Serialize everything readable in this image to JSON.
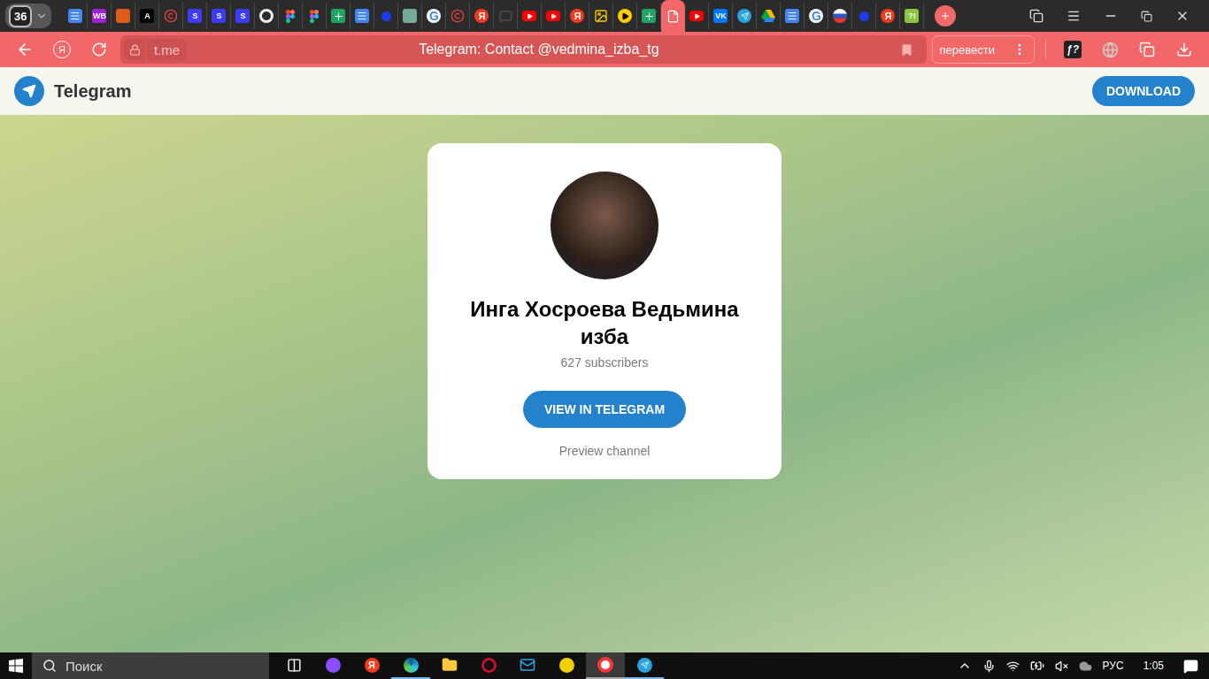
{
  "tab_counter": "36",
  "tabs": [
    {
      "kind": "docs",
      "selected": false
    },
    {
      "kind": "letter",
      "glyph": "WB",
      "color": "#a21fd6",
      "selected": false
    },
    {
      "kind": "tile",
      "color": "#e05a1a",
      "selected": false
    },
    {
      "kind": "letter",
      "glyph": "A",
      "color": "#000000",
      "selected": false
    },
    {
      "kind": "copyright",
      "selected": false
    },
    {
      "kind": "letter",
      "glyph": "S",
      "color": "#3c3cf5",
      "selected": false
    },
    {
      "kind": "letter",
      "glyph": "S",
      "color": "#3c3cf5",
      "selected": false
    },
    {
      "kind": "letter",
      "glyph": "S",
      "color": "#3c3cf5",
      "selected": false
    },
    {
      "kind": "ring",
      "selected": false
    },
    {
      "kind": "figma",
      "selected": false
    },
    {
      "kind": "figma",
      "selected": false
    },
    {
      "kind": "sheet",
      "selected": false
    },
    {
      "kind": "docs",
      "selected": false
    },
    {
      "kind": "dot",
      "selected": false
    },
    {
      "kind": "tile",
      "color": "#74aa9c",
      "selected": false
    },
    {
      "kind": "google",
      "glyph": "G",
      "selected": false
    },
    {
      "kind": "copyright",
      "selected": false
    },
    {
      "kind": "round",
      "glyph": "Я",
      "color": "#f33a1d",
      "selected": false
    },
    {
      "kind": "chat",
      "selected": false
    },
    {
      "kind": "youtube",
      "selected": false
    },
    {
      "kind": "youtube",
      "selected": false
    },
    {
      "kind": "round",
      "glyph": "Я",
      "color": "#f33a1d",
      "selected": false
    },
    {
      "kind": "image",
      "selected": false
    },
    {
      "kind": "play",
      "selected": false
    },
    {
      "kind": "sheet",
      "selected": false
    },
    {
      "kind": "page",
      "selected": true
    },
    {
      "kind": "youtube",
      "selected": false
    },
    {
      "kind": "letter",
      "glyph": "VK",
      "color": "#0077ff",
      "selected": false
    },
    {
      "kind": "telegram",
      "selected": false
    },
    {
      "kind": "drive",
      "selected": false
    },
    {
      "kind": "docs",
      "selected": false
    },
    {
      "kind": "google",
      "glyph": "G",
      "selected": false
    },
    {
      "kind": "flag",
      "selected": false
    },
    {
      "kind": "dot",
      "selected": false
    },
    {
      "kind": "round",
      "glyph": "Я",
      "color": "#f33a1d",
      "selected": false
    },
    {
      "kind": "letter",
      "glyph": "?!",
      "color": "#8cc63f",
      "selected": false
    }
  ],
  "address_bar": {
    "home_glyph": "Я",
    "extension_glyph": "ƒ?",
    "domain": "t.me",
    "title": "Telegram: Contact @vedmina_izba_tg",
    "translate": "перевести"
  },
  "header": {
    "brand": "Telegram",
    "download": "DOWNLOAD"
  },
  "card": {
    "name": "Инга Хосроева Ведьмина изба",
    "subscribers": "627 subscribers",
    "view": "VIEW IN TELEGRAM",
    "preview": "Preview channel"
  },
  "taskbar": {
    "search_placeholder": "Поиск",
    "language": "РУС",
    "time": "1:05",
    "apps": [
      {
        "kind": "taskview",
        "running": false,
        "selected": false
      },
      {
        "kind": "alice",
        "running": false,
        "selected": false
      },
      {
        "kind": "yandex",
        "glyph": "Я",
        "running": false,
        "selected": false
      },
      {
        "kind": "edge",
        "running": true,
        "selected": false
      },
      {
        "kind": "folder",
        "running": false,
        "selected": false
      },
      {
        "kind": "opera",
        "running": false,
        "selected": false
      },
      {
        "kind": "mail",
        "running": false,
        "selected": false
      },
      {
        "kind": "trade",
        "running": false,
        "selected": false
      },
      {
        "kind": "ybrowser",
        "running": true,
        "selected": true
      },
      {
        "kind": "telegram",
        "running": true,
        "selected": false
      }
    ]
  }
}
